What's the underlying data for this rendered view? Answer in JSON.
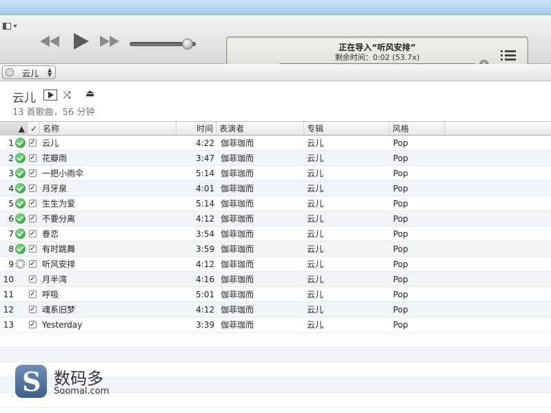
{
  "status": {
    "title": "正在导入“听风安排”",
    "subtitle": "剩余时间：0:02 (53.7x)",
    "progress_fraction": 0.48
  },
  "player": {
    "volume_fraction": 0.88
  },
  "source": {
    "label": "云儿"
  },
  "album": {
    "title": "云儿",
    "meta": "13 首歌曲，56 分钟"
  },
  "columns": {
    "name": "名称",
    "time": "时间",
    "artist": "表演者",
    "album": "专辑",
    "genre": "风格",
    "check": "✓"
  },
  "tracks": [
    {
      "num": "1",
      "status": "done",
      "checked": "✓",
      "name": "云儿",
      "time": "4:22",
      "artist": "伽菲珈而",
      "album": "云儿",
      "genre": "Pop"
    },
    {
      "num": "2",
      "status": "done",
      "checked": "✓",
      "name": "花瓣雨",
      "time": "3:47",
      "artist": "伽菲珈而",
      "album": "云儿",
      "genre": "Pop"
    },
    {
      "num": "3",
      "status": "done",
      "checked": "✓",
      "name": "一把小雨伞",
      "time": "5:14",
      "artist": "伽菲珈而",
      "album": "云儿",
      "genre": "Pop"
    },
    {
      "num": "4",
      "status": "done",
      "checked": "✓",
      "name": "月牙泉",
      "time": "4:01",
      "artist": "伽菲珈而",
      "album": "云儿",
      "genre": "Pop"
    },
    {
      "num": "5",
      "status": "done",
      "checked": "✓",
      "name": "生生为爱",
      "time": "5:14",
      "artist": "伽菲珈而",
      "album": "云儿",
      "genre": "Pop"
    },
    {
      "num": "6",
      "status": "done",
      "checked": "✓",
      "name": "不要分离",
      "time": "4:12",
      "artist": "伽菲珈而",
      "album": "云儿",
      "genre": "Pop"
    },
    {
      "num": "7",
      "status": "done",
      "checked": "✓",
      "name": "眷恋",
      "time": "3:54",
      "artist": "伽菲珈而",
      "album": "云儿",
      "genre": "Pop"
    },
    {
      "num": "8",
      "status": "done",
      "checked": "✓",
      "name": "有时跳舞",
      "time": "3:59",
      "artist": "伽菲珈而",
      "album": "云儿",
      "genre": "Pop"
    },
    {
      "num": "9",
      "status": "importing",
      "checked": "✓",
      "name": "听风安排",
      "time": "4:12",
      "artist": "伽菲珈而",
      "album": "云儿",
      "genre": "Pop"
    },
    {
      "num": "10",
      "status": "pending",
      "checked": "✓",
      "name": "月半湾",
      "time": "4:16",
      "artist": "伽菲珈而",
      "album": "云儿",
      "genre": "Pop"
    },
    {
      "num": "11",
      "status": "pending",
      "checked": "✓",
      "name": "呼吸",
      "time": "5:01",
      "artist": "伽菲珈而",
      "album": "云儿",
      "genre": "Pop"
    },
    {
      "num": "12",
      "status": "pending",
      "checked": "✓",
      "name": "魂系旧梦",
      "time": "4:12",
      "artist": "伽菲珈而",
      "album": "云儿",
      "genre": "Pop"
    },
    {
      "num": "13",
      "status": "pending",
      "checked": "✓",
      "name": "Yesterday",
      "time": "3:39",
      "artist": "伽菲珈而",
      "album": "云儿",
      "genre": "Pop"
    }
  ],
  "watermark": {
    "logo_letter": "S",
    "cn": "数码多",
    "en": "Soomal.com"
  },
  "colors": {
    "done_green": "#1f9b2f",
    "alt_row": "#f1f5fa"
  }
}
